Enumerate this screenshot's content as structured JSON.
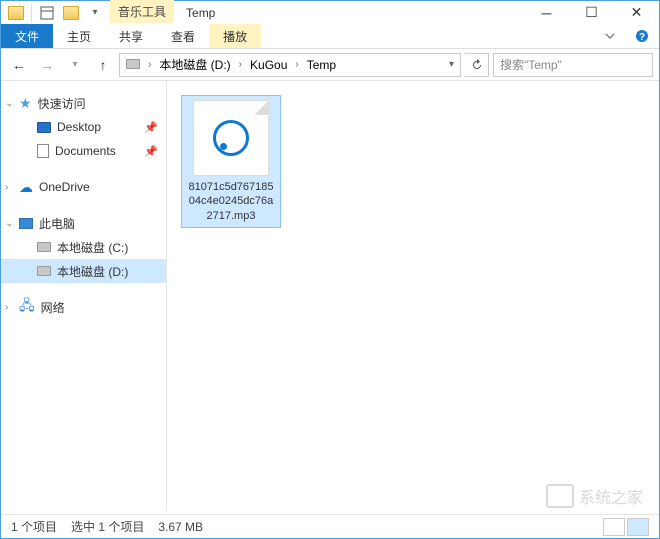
{
  "titlebar": {
    "context_label": "音乐工具",
    "window_title": "Temp"
  },
  "ribbon": {
    "file": "文件",
    "home": "主页",
    "share": "共享",
    "view": "查看",
    "play": "播放"
  },
  "breadcrumb": {
    "drive": "本地磁盘 (D:)",
    "folder1": "KuGou",
    "folder2": "Temp"
  },
  "search": {
    "placeholder": "搜索\"Temp\""
  },
  "nav": {
    "quick_access": "快速访问",
    "desktop": "Desktop",
    "documents": "Documents",
    "onedrive": "OneDrive",
    "this_pc": "此电脑",
    "drive_c": "本地磁盘 (C:)",
    "drive_d": "本地磁盘 (D:)",
    "network": "网络"
  },
  "files": {
    "item1": {
      "name": "81071c5d76718504c4e0245dc76a2717.mp3"
    }
  },
  "status": {
    "count": "1 个项目",
    "selection": "选中 1 个项目",
    "size": "3.67 MB"
  },
  "watermark": "系统之家"
}
